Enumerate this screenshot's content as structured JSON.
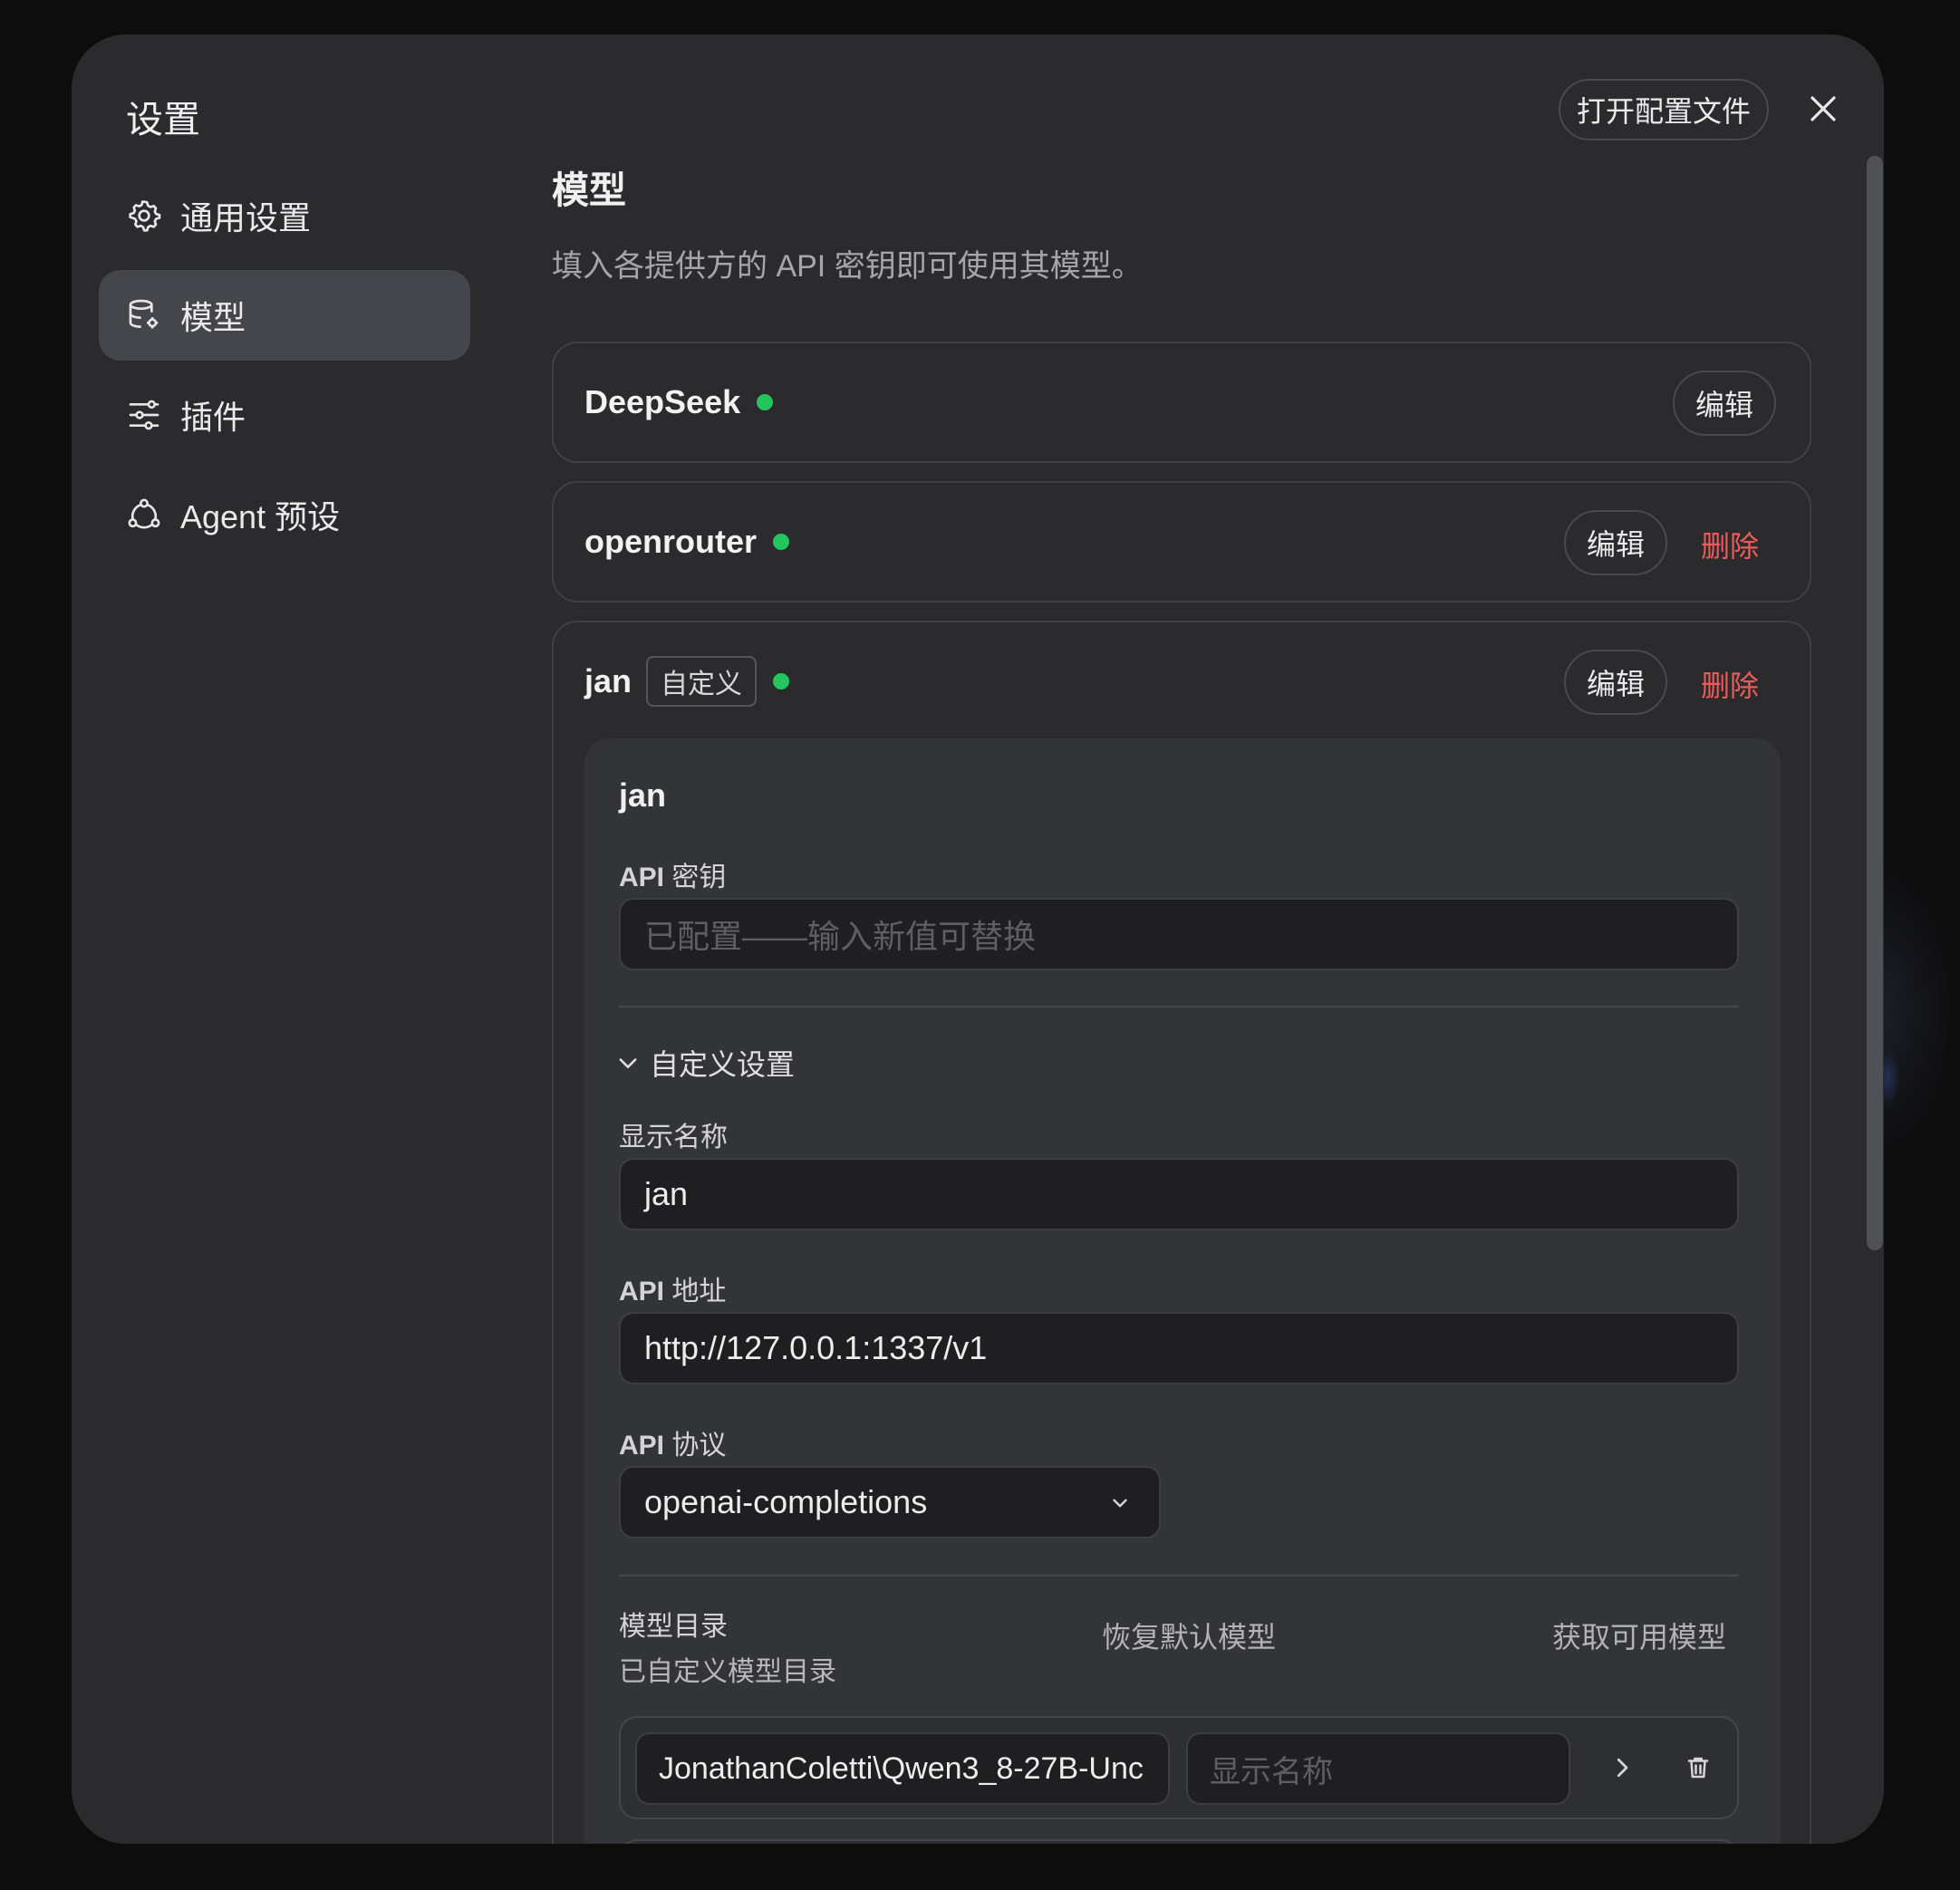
{
  "dialog": {
    "title": "设置",
    "open_config_label": "打开配置文件"
  },
  "nav": {
    "items": [
      {
        "label": "通用设置",
        "icon": "gear-icon"
      },
      {
        "label": "模型",
        "icon": "database-gear-icon"
      },
      {
        "label": "插件",
        "icon": "sliders-icon"
      },
      {
        "label": "Agent 预设",
        "icon": "agent-icon"
      }
    ],
    "active_index": 1
  },
  "section": {
    "title": "模型",
    "description": "填入各提供方的 API 密钥即可使用其模型。"
  },
  "providers": [
    {
      "name": "DeepSeek",
      "status_color": "#22c55e",
      "edit_label": "编辑"
    },
    {
      "name": "openrouter",
      "status_color": "#22c55e",
      "edit_label": "编辑",
      "delete_label": "删除"
    },
    {
      "name": "jan",
      "tag": "自定义",
      "status_color": "#22c55e",
      "edit_label": "编辑",
      "delete_label": "删除"
    }
  ],
  "jan_form": {
    "title": "jan",
    "api_key_label_strong": "API",
    "api_key_label_rest": " 密钥",
    "api_key_placeholder": "已配置——输入新值可替换",
    "custom_settings_label": "自定义设置",
    "display_name_label": "显示名称",
    "display_name_value": "jan",
    "api_url_label_strong": "API",
    "api_url_label_rest": " 地址",
    "api_url_value": "http://127.0.0.1:1337/v1",
    "api_protocol_label_strong": "API",
    "api_protocol_label_rest": " 协议",
    "api_protocol_value": "openai-completions",
    "catalog_label": "模型目录",
    "catalog_sub": "已自定义模型目录",
    "restore_default_label": "恢复默认模型",
    "fetch_models_label": "获取可用模型",
    "catalog_rows": [
      {
        "model_id": "JonathanColetti\\Qwen3_8-27B-Unc",
        "display_name_placeholder": "显示名称"
      }
    ]
  },
  "colors": {
    "accent_status": "#22c55e",
    "danger": "#ef5b5b",
    "background": "#2b2b2e"
  }
}
